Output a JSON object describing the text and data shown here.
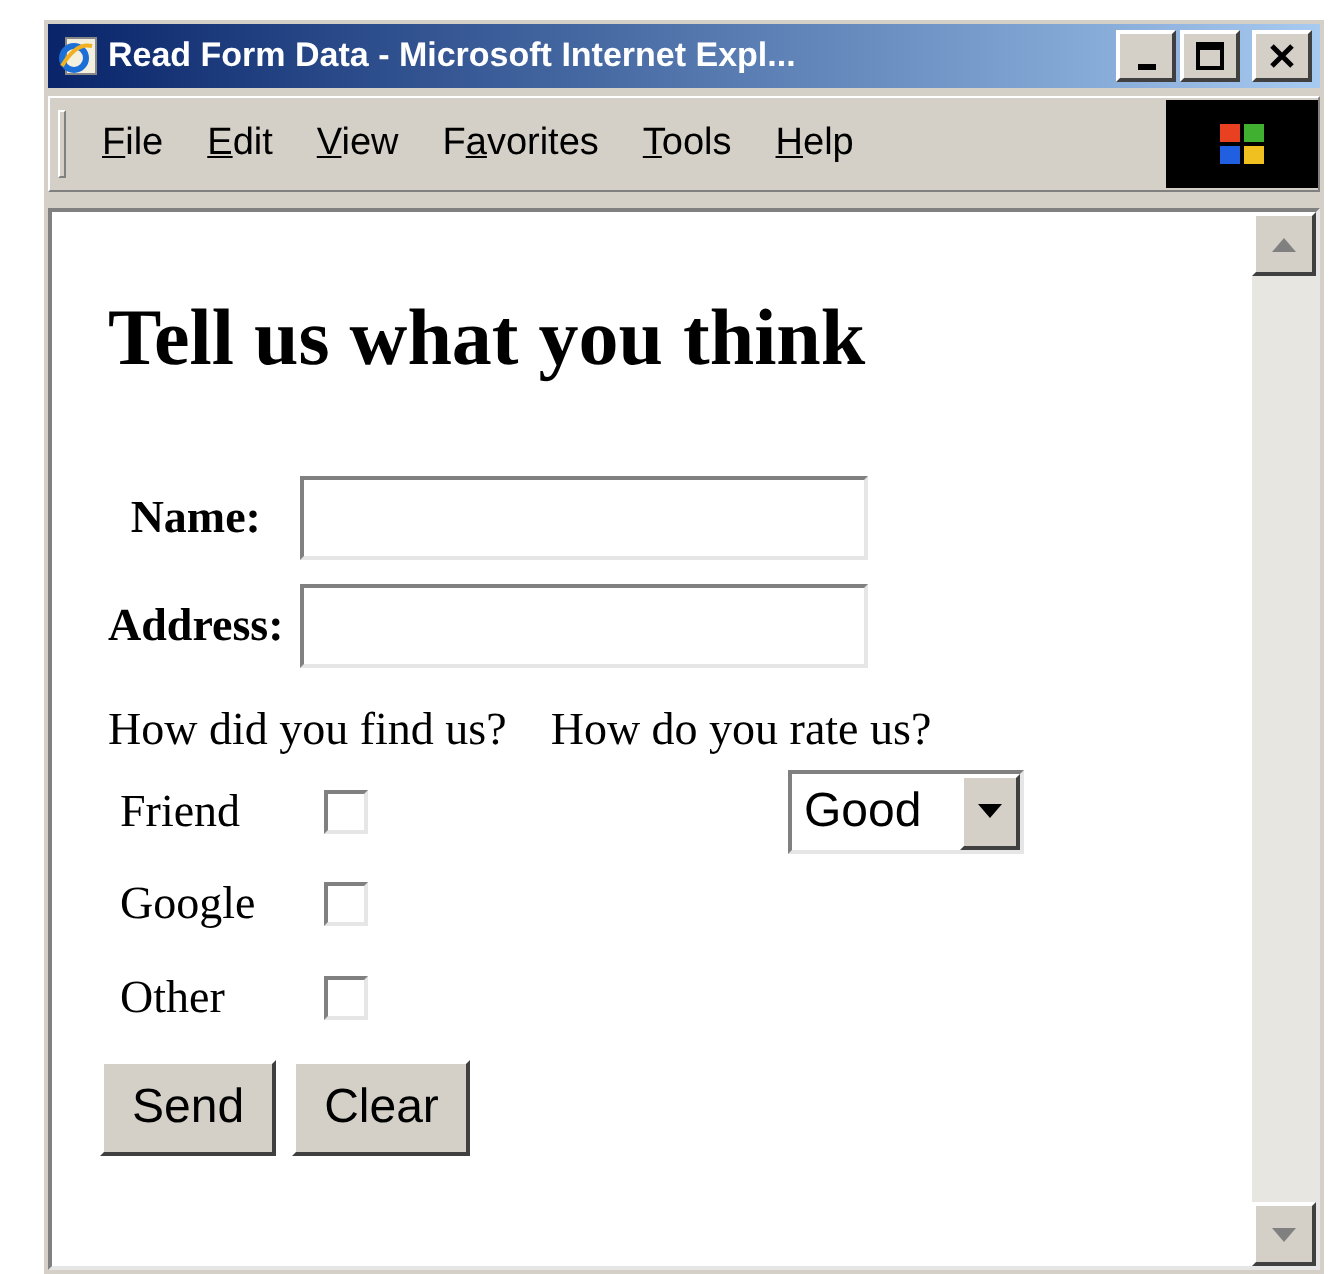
{
  "window": {
    "title": "Read Form Data - Microsoft Internet Expl..."
  },
  "menu": [
    {
      "key": "F",
      "post": "ile"
    },
    {
      "key": "E",
      "post": "dit"
    },
    {
      "key": "V",
      "post": "iew"
    },
    {
      "pre": "F",
      "key": "a",
      "post": "vorites"
    },
    {
      "key": "T",
      "post": "ools"
    },
    {
      "key": "H",
      "post": "elp"
    }
  ],
  "page": {
    "heading": "Tell us what you think",
    "fields": [
      {
        "label": "Name:"
      },
      {
        "label": "Address:"
      }
    ],
    "find_prompt": "How did you find us?",
    "rate_prompt": "How do you rate us?",
    "sources": [
      {
        "label": "Friend",
        "checked": false
      },
      {
        "label": "Google",
        "checked": false
      },
      {
        "label": "Other",
        "checked": false
      }
    ],
    "rating": {
      "value": "Good"
    },
    "buttons": [
      "Send",
      "Clear"
    ]
  }
}
